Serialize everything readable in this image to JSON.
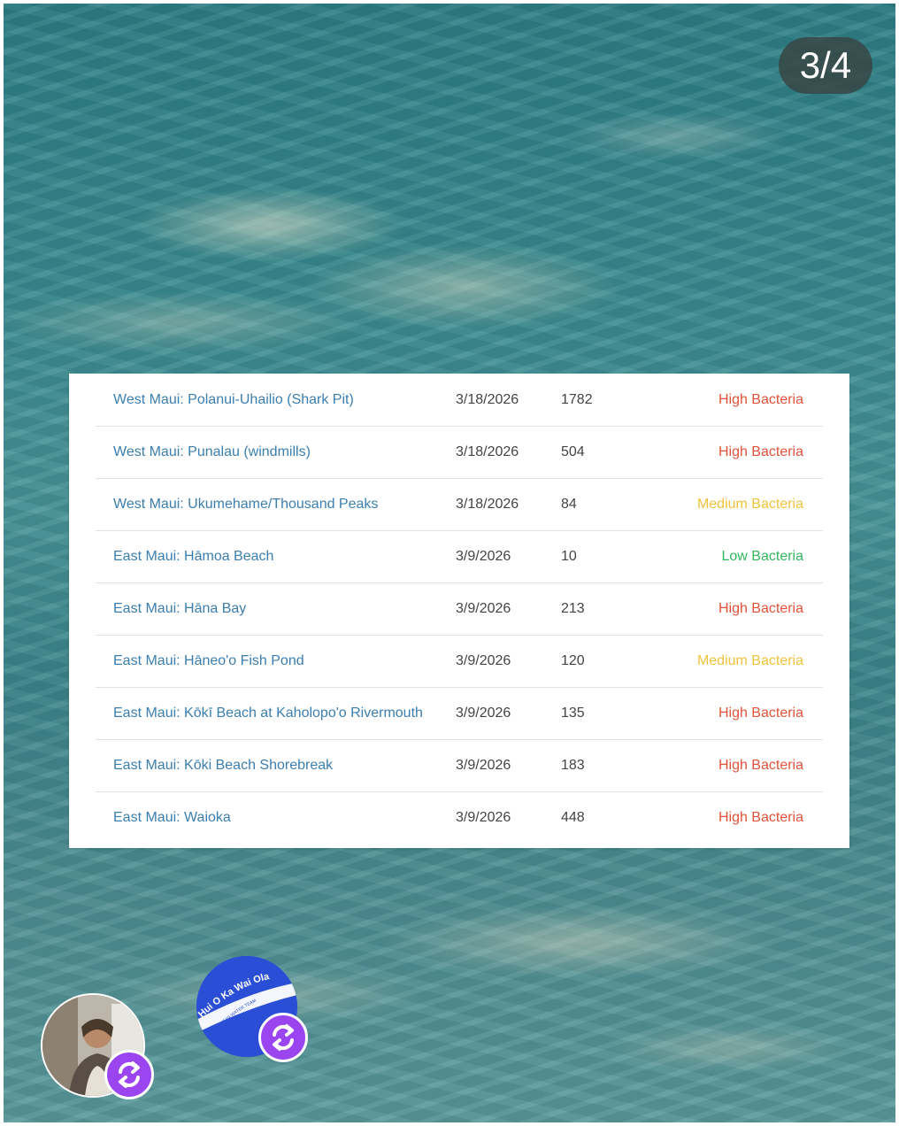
{
  "story": {
    "counter": "3/4"
  },
  "table": {
    "rows": [
      {
        "location": "West Maui: Polanui-Uhailio (Shark Pit)",
        "date": "3/18/2026",
        "value": "1782",
        "status": "High Bacteria",
        "level": "high"
      },
      {
        "location": "West Maui: Punalau (windmills)",
        "date": "3/18/2026",
        "value": "504",
        "status": "High Bacteria",
        "level": "high"
      },
      {
        "location": "West Maui: Ukumehame/Thousand Peaks",
        "date": "3/18/2026",
        "value": "84",
        "status": "Medium Bacteria",
        "level": "medium"
      },
      {
        "location": "East Maui: Hāmoa Beach",
        "date": "3/9/2026",
        "value": "10",
        "status": "Low Bacteria",
        "level": "low"
      },
      {
        "location": "East Maui: Hāna Bay",
        "date": "3/9/2026",
        "value": "213",
        "status": "High Bacteria",
        "level": "high"
      },
      {
        "location": "East Maui: Hāneo'o Fish Pond",
        "date": "3/9/2026",
        "value": "120",
        "status": "Medium Bacteria",
        "level": "medium"
      },
      {
        "location": "East Maui: Kōkī Beach at Kaholopo'o Rivermouth",
        "date": "3/9/2026",
        "value": "135",
        "status": "High Bacteria",
        "level": "high"
      },
      {
        "location": "East Maui: Kōki Beach Shorebreak",
        "date": "3/9/2026",
        "value": "183",
        "status": "High Bacteria",
        "level": "high"
      },
      {
        "location": "East Maui: Waioka",
        "date": "3/9/2026",
        "value": "448",
        "status": "High Bacteria",
        "level": "high"
      }
    ]
  },
  "colors": {
    "location_link": "#3c7eae",
    "high": "#e0533a",
    "medium": "#efc33e",
    "low": "#33b85e",
    "repost_badge": "#9b45f0",
    "org_avatar": "#2a4fd6"
  },
  "avatars": {
    "org_logo_text": "Hui O Ka Wai Ola",
    "org_logo_subtext": "CLEAN WATER TEAM",
    "badge_icon": "repost-icon"
  }
}
